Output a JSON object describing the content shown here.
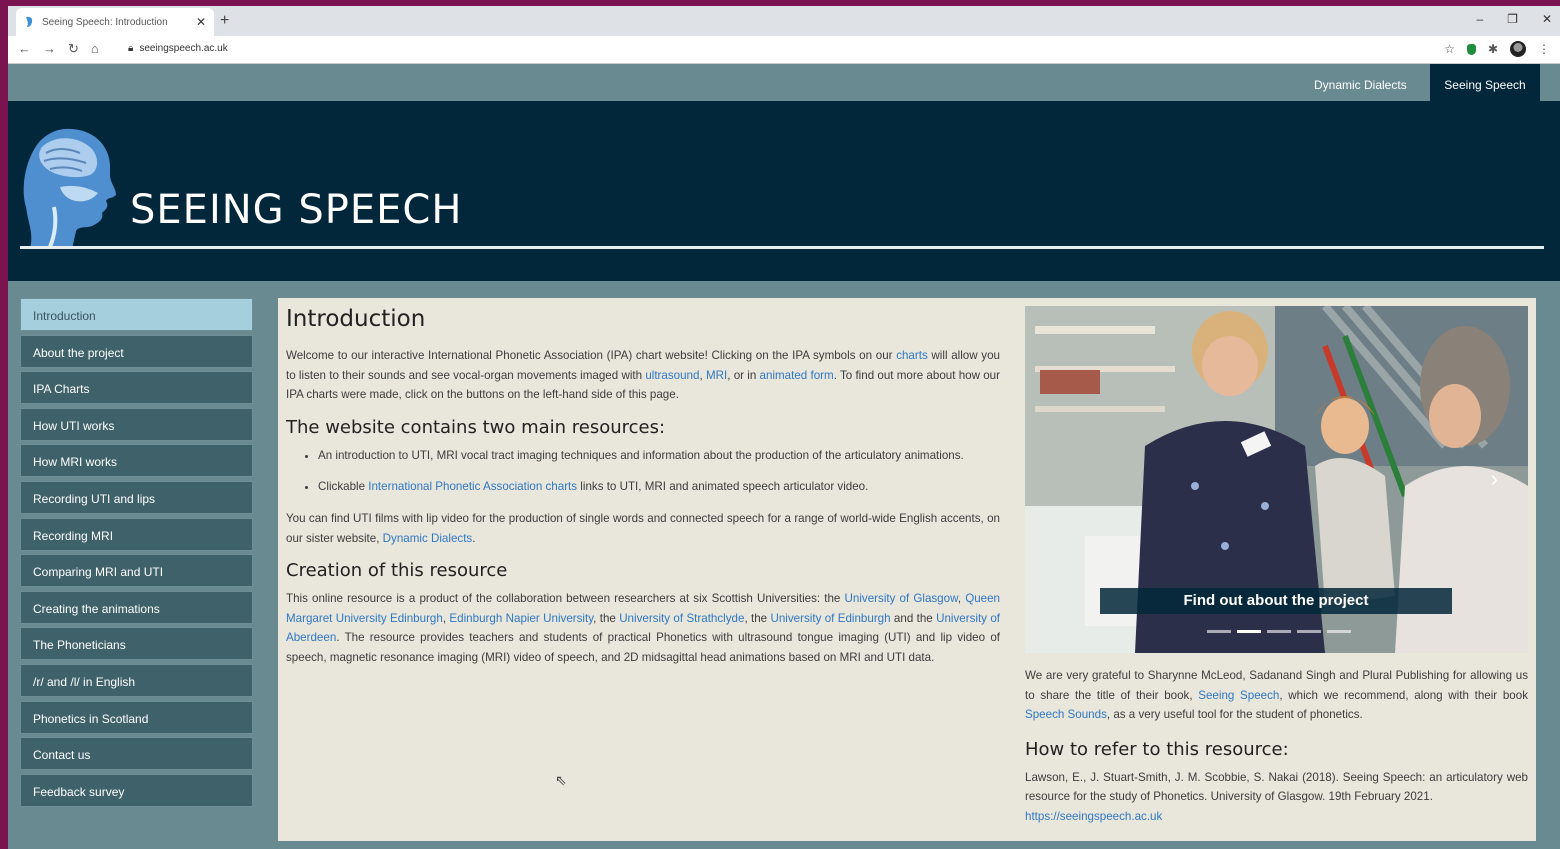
{
  "browser": {
    "tab_title": "Seeing Speech: Introduction",
    "url": "seeingspeech.ac.uk"
  },
  "topnav": {
    "items": [
      "Dynamic Dialects",
      "Seeing Speech"
    ]
  },
  "site": {
    "title": "SEEING SPEECH"
  },
  "sidebar": {
    "items": [
      {
        "label": "Introduction"
      },
      {
        "label": "About the project"
      },
      {
        "label": "IPA Charts"
      },
      {
        "label": "How UTI works"
      },
      {
        "label": "How MRI works"
      },
      {
        "label": "Recording UTI and lips"
      },
      {
        "label": "Recording MRI"
      },
      {
        "label": "Comparing MRI and UTI"
      },
      {
        "label": "Creating the animations"
      },
      {
        "label": "The Phoneticians"
      },
      {
        "label": "/r/ and /l/ in English"
      },
      {
        "label": "Phonetics in Scotland"
      },
      {
        "label": "Contact us"
      },
      {
        "label": "Feedback survey"
      }
    ]
  },
  "main": {
    "heading": "Introduction",
    "intro": {
      "t1": "Welcome to our interactive International Phonetic Association (IPA) chart website! Clicking on the IPA symbols on our ",
      "l1": "charts",
      "t2": " will allow you to listen to their sounds and see vocal-organ movements imaged with ",
      "l2": "ultrasound",
      "t3": ", ",
      "l3": "MRI",
      "t4": ", or in ",
      "l4": "animated form",
      "t5": ". To find out more about how our IPA charts were made, click on the buttons on the left-hand side of this page."
    },
    "resources_heading": "The website contains two main resources:",
    "bullet1": "An introduction to UTI, MRI vocal tract imaging techniques and information about the production of the articulatory animations.",
    "bullet2": {
      "t1": "Clickable ",
      "l1": "International Phonetic Association charts",
      "t2": " links to UTI, MRI and animated speech articulator video."
    },
    "sister": {
      "t1": "You can find UTI films with lip video for the production of single words and connected speech for a range of world-wide English accents, on our sister website, ",
      "l1": "Dynamic Dialects",
      "t2": "."
    },
    "creation_heading": "Creation of this resource",
    "creation": {
      "t1": "This online resource is a product of the collaboration between researchers at six Scottish Universities: the ",
      "l1": "University of Glasgow",
      "t2": ", ",
      "l2": "Queen Margaret University Edinburgh",
      "t3": ", ",
      "l3": "Edinburgh Napier University",
      "t4": ", the ",
      "l4": "University of Strathclyde",
      "t5": ", the ",
      "l5": "University of Edinburgh",
      "t6": " and the ",
      "l6": "University of Aberdeen",
      "t7": ". The resource provides teachers and students of practical Phonetics with ultrasound tongue imaging (UTI) and lip video of speech, magnetic resonance imaging (MRI) video of speech, and 2D midsagittal head animations based on MRI and UTI data."
    }
  },
  "carousel": {
    "caption": "Find out about the project",
    "slide_count": 5,
    "active_slide": 2
  },
  "right": {
    "thanks": {
      "t1": "We are very grateful to Sharynne McLeod, Sadanand Singh and Plural Publishing for allowing us to share the title of their book, ",
      "l1": "Seeing Speech",
      "t2": ", which we recommend, along with their book ",
      "l2": "Speech Sounds",
      "t3": ", as a very useful tool for the student of phonetics."
    },
    "refer_heading": "How to refer to this resource:",
    "citation": "Lawson, E., J. Stuart-Smith, J. M. Scobbie, S. Nakai (2018). Seeing Speech: an articulatory web resource for the study of Phonetics. University of Glasgow. 19th February 2021.",
    "citation_link": "https://seeingspeech.ac.uk"
  }
}
